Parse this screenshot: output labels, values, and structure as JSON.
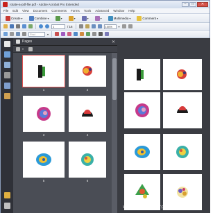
{
  "window": {
    "title": "rotate-a-pdf-file.pdf - Adobe Acrobat Pro Extended",
    "controls": [
      "–",
      "□",
      "✕"
    ]
  },
  "menu": [
    "File",
    "Edit",
    "View",
    "Document",
    "Comments",
    "Forms",
    "Tools",
    "Advanced",
    "Window",
    "Help"
  ],
  "toolbar1": {
    "create_label": "Create",
    "combine_label": "Combine",
    "multimedia_label": "Multimedia",
    "comment_label": "Comment"
  },
  "toolbar2": {
    "page_current": "1",
    "page_total": "/ 16",
    "zoom_value": "100%"
  },
  "toolbar3": {
    "find_placeholder": "Find"
  },
  "pages_panel": {
    "title": "Pages",
    "close_glyph": "✕",
    "options_glyph": "▾",
    "thumb_labels": [
      "1",
      "2",
      "3",
      "4",
      "5",
      "6"
    ]
  },
  "watermark": "www.wintips.org",
  "colors": {
    "accent": "#c8221b",
    "panel_bg": "#4a4d55",
    "doc_bg": "#3a3c42",
    "selected_outline": "#e05050"
  },
  "icons": {
    "app": "acrobat-icon",
    "nav": [
      "pages-icon",
      "bookmarks-icon",
      "signatures-icon",
      "attachments-icon",
      "layers-icon",
      "model-tree-icon",
      "comments-icon",
      "search-icon"
    ]
  }
}
